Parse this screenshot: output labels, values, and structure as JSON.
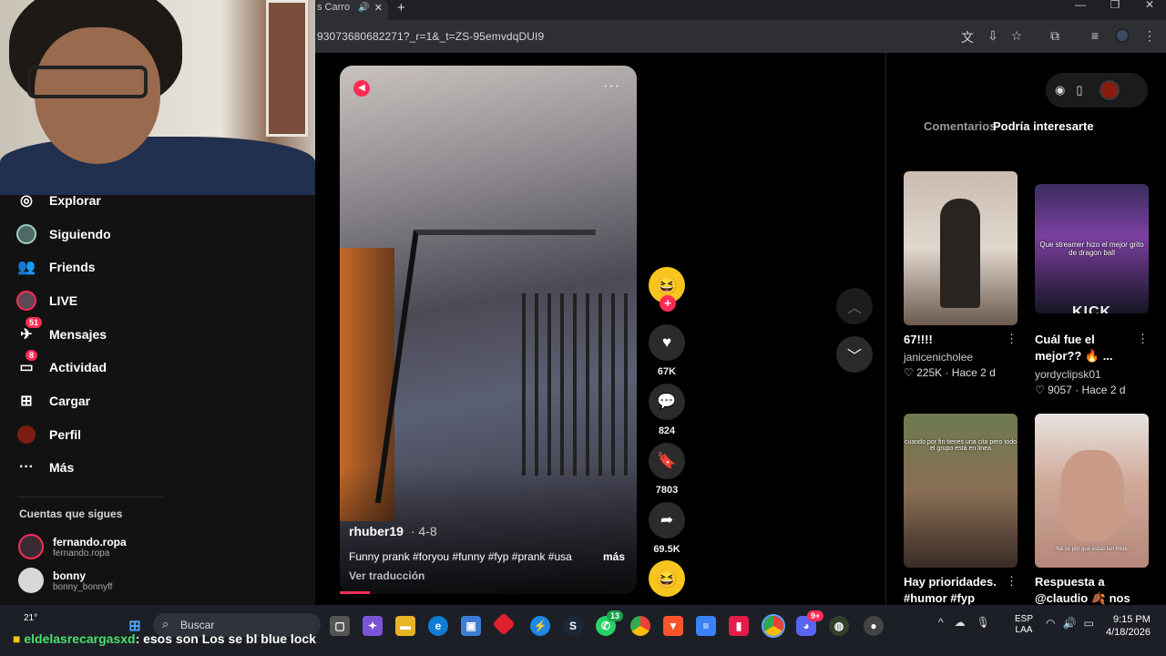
{
  "browser": {
    "tab_title": "s Carro",
    "url": "93073680682271?_r=1&_t=ZS-95emvdqDUI9"
  },
  "nav": {
    "items": [
      {
        "label": "Explorar",
        "icon": "compass-icon"
      },
      {
        "label": "Siguiendo",
        "icon": "following-avatar-icon"
      },
      {
        "label": "Friends",
        "icon": "friends-icon"
      },
      {
        "label": "LIVE",
        "icon": "live-icon"
      },
      {
        "label": "Mensajes",
        "icon": "messages-icon",
        "badge": "51"
      },
      {
        "label": "Actividad",
        "icon": "activity-icon",
        "badge": "8"
      },
      {
        "label": "Cargar",
        "icon": "upload-icon"
      },
      {
        "label": "Perfil",
        "icon": "profile-icon"
      },
      {
        "label": "Más",
        "icon": "more-icon"
      }
    ],
    "following_title": "Cuentas que sigues",
    "accounts": [
      {
        "name": "fernando.ropa",
        "handle": "fernando.ropa"
      },
      {
        "name": "bonny",
        "handle": "bonny_bonnyff"
      }
    ]
  },
  "video": {
    "author": "rhuber19",
    "date": "4-8",
    "caption": "Funny prank #foryou #funny #fyp #prank #usa",
    "more_label": "más",
    "translate_label": "Ver traducción",
    "progress": 0.1,
    "likes": "67K",
    "comments": "824",
    "saves": "7803",
    "shares": "69.5K"
  },
  "panel": {
    "tab_comments": "Comentarios",
    "tab_interest": "Podría interesarte",
    "cards": [
      {
        "title": "67!!!!",
        "user": "janicenicholee",
        "likes": "225K",
        "when": "Hace 2 d",
        "thumb_text": ""
      },
      {
        "title": "Cuál fue el mejor?? 🔥 ...",
        "user": "yordyclipsk01",
        "likes": "9057",
        "when": "Hace 2 d",
        "thumb_text": "Que streamer hizo el mejor grito de dragon ball",
        "logo": "KICK"
      },
      {
        "title": "Hay prioridades. #humor #fyp",
        "user": "",
        "likes": "",
        "when": "",
        "thumb_text": "cuando por fin tienes una cita pero todo el grupo está en linea"
      },
      {
        "title": "Respuesta a @claudio 🍂 nos",
        "user": "",
        "likes": "",
        "when": "",
        "thumb_text": "Na se por que estas tan triste"
      }
    ]
  },
  "taskbar": {
    "weather": "21°",
    "search_placeholder": "Buscar",
    "chat_user": "eldelasrecargasxd",
    "chat_msg": ": esos son Los se bl blue lock",
    "lang_line1": "ESP",
    "lang_line2": "LAA",
    "time": "9:15 PM",
    "date": "4/18/2026",
    "whatsapp_badge": "13",
    "discord_badge": "9+"
  },
  "colors": {
    "accent": "#fe2c55",
    "background": "#000000",
    "chat_user": "#49e06b"
  }
}
